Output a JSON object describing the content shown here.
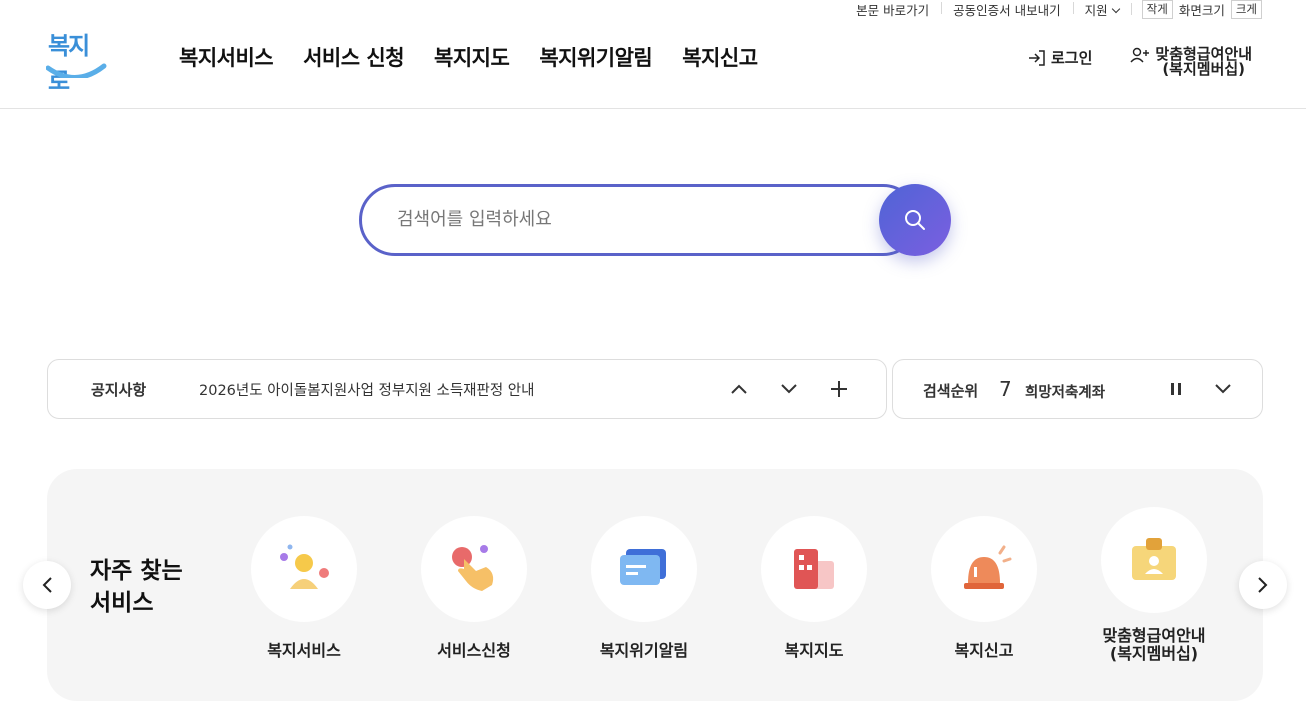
{
  "utility": {
    "skip": "본문 바로가기",
    "cert": "공동인증서 내보내기",
    "support": "지원",
    "small": "작게",
    "screen_size": "화면크기",
    "large": "크게"
  },
  "logo": {
    "text": "복지로"
  },
  "gnb": [
    "복지서비스",
    "서비스 신청",
    "복지지도",
    "복지위기알림",
    "복지신고"
  ],
  "header_right": {
    "login": "로그인",
    "member_line1": "맞춤형급여안내",
    "member_line2": "(복지멤버십)"
  },
  "search": {
    "placeholder": "검색어를 입력하세요",
    "value": ""
  },
  "notice": {
    "title": "공지사항",
    "text": "2026년도 아이돌봄지원사업 정부지원 소득재판정 안내"
  },
  "rank": {
    "title": "검색순위",
    "number": "7",
    "keyword": "희망저축계좌"
  },
  "frequent": {
    "heading_line1": "자주 찾는",
    "heading_line2": "서비스",
    "items": [
      {
        "label": "복지서비스",
        "icon": "person-icon"
      },
      {
        "label": "서비스신청",
        "icon": "hand-tap-icon"
      },
      {
        "label": "복지위기알림",
        "icon": "message-icon"
      },
      {
        "label": "복지지도",
        "icon": "building-map-icon"
      },
      {
        "label": "복지신고",
        "icon": "siren-icon"
      },
      {
        "label_line1": "맞춤형급여안내",
        "label_line2": "(복지멤버십)",
        "icon": "id-card-icon"
      }
    ]
  },
  "colors": {
    "accent": "#5a62c9",
    "brand": "#3a8fd8"
  }
}
